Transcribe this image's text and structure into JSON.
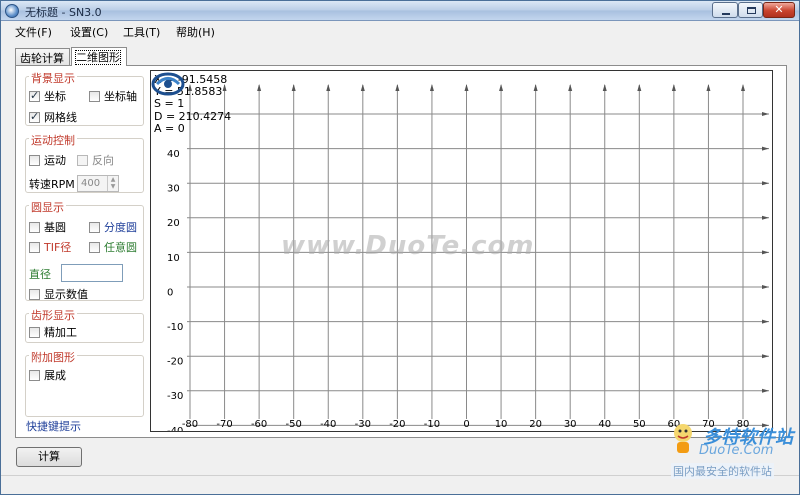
{
  "window": {
    "title": "无标题 - SN3.0"
  },
  "menu": [
    "文件(F)",
    "设置(C)",
    "工具(T)",
    "帮助(H)"
  ],
  "tabs": [
    "齿轮计算",
    "二维图形"
  ],
  "left": {
    "bg_title": "背景显示",
    "cb_coord": "坐标",
    "cb_axis": "坐标轴",
    "cb_grid": "网格线",
    "motion_title": "运动控制",
    "cb_motion": "运动",
    "cb_reverse": "反向",
    "rpm_label": "转速RPM",
    "rpm_value": "400",
    "circle_title": "圆显示",
    "cb_base": "基圆",
    "cb_pitch": "分度圆",
    "cb_tif": "TIF径",
    "cb_any": "任意圆",
    "diameter_label": "直径",
    "cb_showval": "显示数值",
    "tooth_title": "齿形显示",
    "cb_finish": "精加工",
    "extra_title": "附加图形",
    "cb_expand": "展成",
    "shortcut": "快捷键提示"
  },
  "readout": {
    "x": "X = -91.5458",
    "y": "Y = 51.8583",
    "s": "S = 1",
    "d": "D = 210.4274",
    "a": "A = 0"
  },
  "chart_data": {
    "type": "grid",
    "x_ticks": [
      "-80",
      "-70",
      "-60",
      "-50",
      "-40",
      "-30",
      "-20",
      "-10",
      "0",
      "10",
      "20",
      "30",
      "40",
      "50",
      "60",
      "70",
      "80"
    ],
    "y_ticks": [
      "40",
      "30",
      "20",
      "10",
      "0",
      "-10",
      "-20",
      "-30",
      "-40"
    ],
    "xlim": [
      -80,
      80
    ],
    "ylim": [
      -40,
      40
    ]
  },
  "watermark": "www.DuoTe.com",
  "calc_button": "计算",
  "site": {
    "brand": "多特软件站",
    "brand_url": "DuoTe.Com",
    "tagline": "国内最安全的软件站"
  }
}
